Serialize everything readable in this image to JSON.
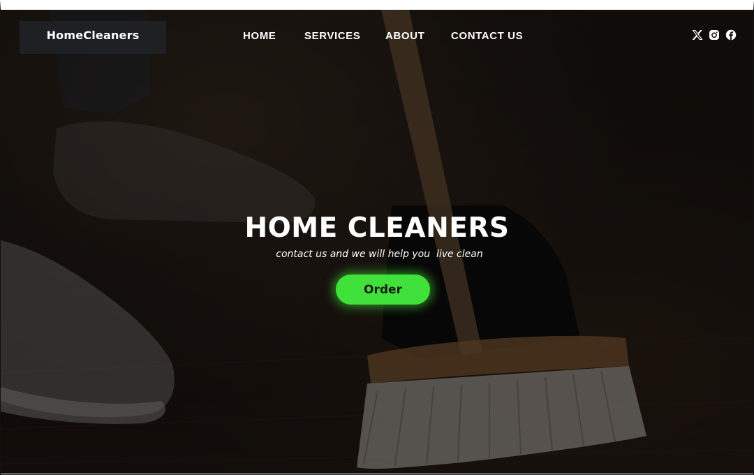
{
  "header": {
    "logo": "HomeCleaners",
    "nav": {
      "home": "HOME",
      "services": "SERVICES",
      "about": "ABOUT",
      "contact": "CONTACT US"
    },
    "social_icons": [
      "x-icon",
      "instagram-icon",
      "facebook-icon"
    ]
  },
  "hero": {
    "title": "HOME CLEANERS",
    "subtitle": "contact us and we will help you  live clean",
    "order_label": "Order",
    "background_image": "cleaning-broom-photo"
  },
  "colors": {
    "accent": "#3fe13a",
    "logo_background": "#1f2023",
    "text": "#ffffff"
  }
}
